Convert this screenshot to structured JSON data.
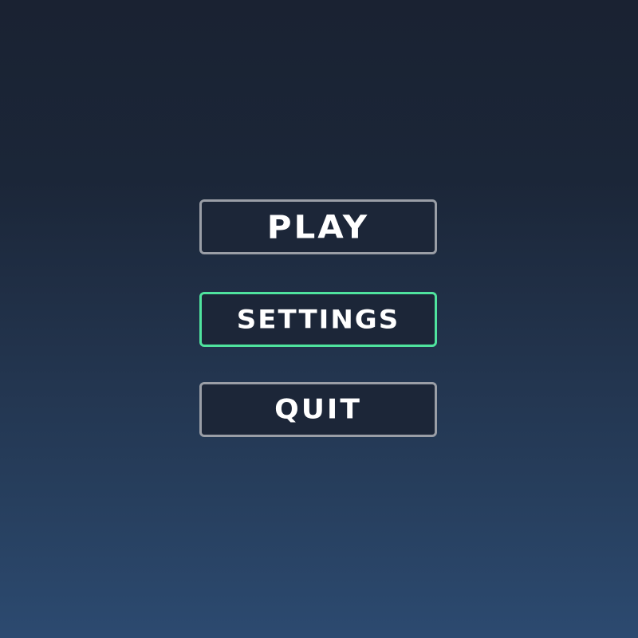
{
  "menu": {
    "items": [
      {
        "id": "play",
        "label": "PLAY",
        "selected": false
      },
      {
        "id": "settings",
        "label": "SETTINGS",
        "selected": true
      },
      {
        "id": "quit",
        "label": "QUIT",
        "selected": false
      }
    ]
  },
  "colors": {
    "background_top": "#1a2232",
    "background_bottom": "#2c4a70",
    "button_border": "#9a9ea6",
    "button_border_selected": "#4fe39e",
    "button_fill": "#1c2638",
    "label": "#ffffff"
  }
}
